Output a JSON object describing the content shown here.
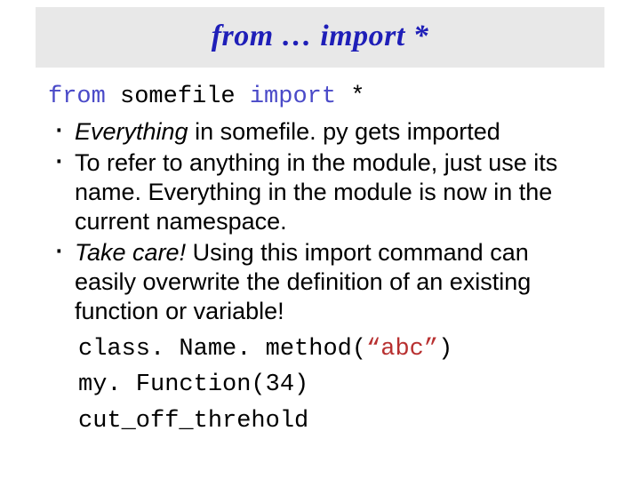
{
  "title": "from … import  *",
  "code_line_html": "<span class=\"kw\">from</span> somefile <span class=\"kw\">import</span> *",
  "bullets": [
    {
      "html": "<em>Everything</em> in somefile. py gets imported"
    },
    {
      "html": "To refer to anything in the module, just use its name. Everything in the module is now in the current namespace."
    },
    {
      "html": "<em>Take care!</em> Using this import command can easily overwrite the definition of an existing function or variable!"
    }
  ],
  "examples": [
    {
      "html": "class. Name. method(<span class=\"str\">“abc”</span>)"
    },
    {
      "html": "my. Function(34)"
    },
    {
      "html": "cut_off_threhold"
    }
  ]
}
